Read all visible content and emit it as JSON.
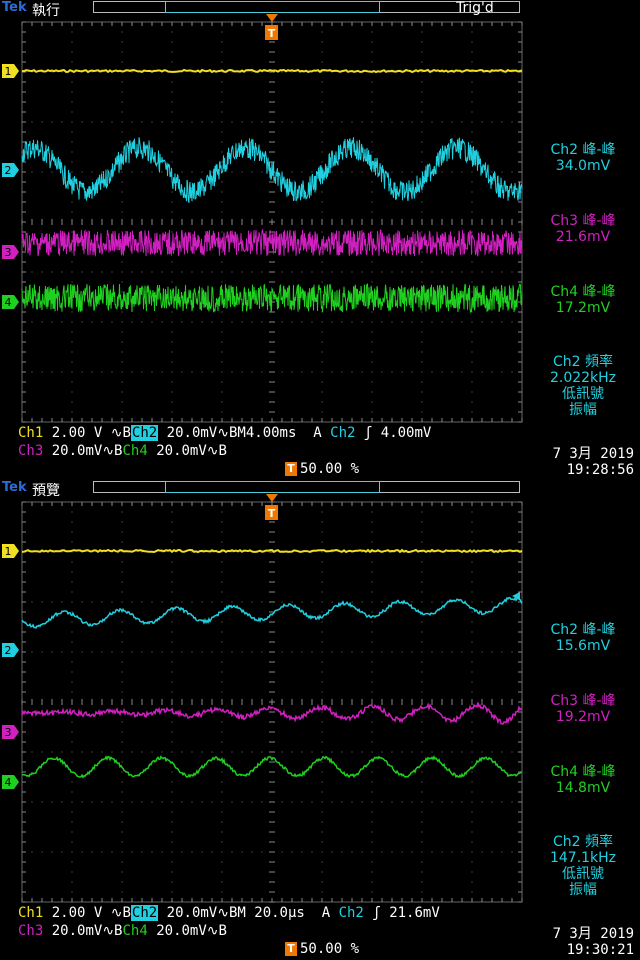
{
  "colors": {
    "ch1": "#f0e020",
    "ch2": "#20d0e0",
    "ch3": "#d020c0",
    "ch4": "#20d020",
    "trigger": "#f07800"
  },
  "screens": [
    {
      "brand": "Tek",
      "mode": "執行",
      "trig_status": "Trig'd",
      "ch1_scale": "2.00 V",
      "ch2_scale": "20.0mV",
      "ch3_scale": "20.0mV",
      "ch4_scale": "20.0mV",
      "bw_symbol": "∿B",
      "timebase": "M4.00ms",
      "trigger_mode": "A",
      "trigger_source": "Ch2",
      "trigger_slope": "ʃ",
      "trigger_level": "4.00mV",
      "trigger_position": "50.00 %",
      "date": "7 3月  2019",
      "time": "19:28:56",
      "meas": [
        {
          "label": "Ch2 峰-峰",
          "value": "34.0mV"
        },
        {
          "label": "Ch3 峰-峰",
          "value": "21.6mV"
        },
        {
          "label": "Ch4 峰-峰",
          "value": "17.2mV"
        }
      ],
      "freq": {
        "label": "Ch2 頻率",
        "value": "2.022kHz",
        "note1": "低訊號",
        "note2": "振幅"
      }
    },
    {
      "brand": "Tek",
      "mode": "預覽",
      "trig_status": "",
      "ch1_scale": "2.00 V",
      "ch2_scale": "20.0mV",
      "ch3_scale": "20.0mV",
      "ch4_scale": "20.0mV",
      "bw_symbol": "∿B",
      "timebase": "M 20.0μs",
      "trigger_mode": "A",
      "trigger_source": "Ch2",
      "trigger_slope": "ʃ",
      "trigger_level": "21.6mV",
      "trigger_position": "50.00 %",
      "date": "7 3月  2019",
      "time": "19:30:21",
      "meas": [
        {
          "label": "Ch2 峰-峰",
          "value": "15.6mV"
        },
        {
          "label": "Ch3 峰-峰",
          "value": "19.2mV"
        },
        {
          "label": "Ch4 峰-峰",
          "value": "14.8mV"
        }
      ],
      "freq": {
        "label": "Ch2 頻率",
        "value": "147.1kHz",
        "note1": "低訊號",
        "note2": "振幅"
      }
    }
  ]
}
